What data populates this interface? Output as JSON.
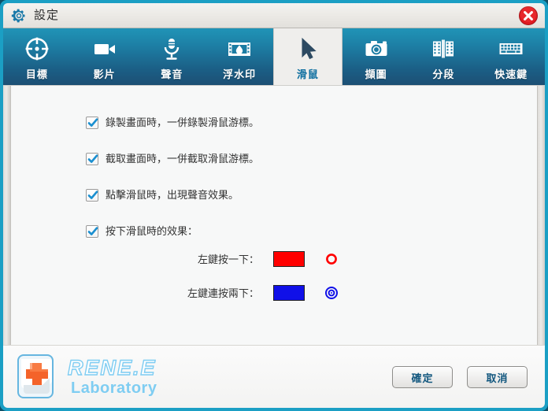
{
  "window": {
    "title": "設定",
    "gear_icon": "gear-icon",
    "close_icon": "close-icon"
  },
  "tabs": [
    {
      "label": "目標",
      "icon": "target-icon",
      "active": false
    },
    {
      "label": "影片",
      "icon": "video-camera-icon",
      "active": false
    },
    {
      "label": "聲音",
      "icon": "microphone-icon",
      "active": false
    },
    {
      "label": "浮水印",
      "icon": "watermark-icon",
      "active": false
    },
    {
      "label": "滑鼠",
      "icon": "cursor-arrow-icon",
      "active": true
    },
    {
      "label": "擷圖",
      "icon": "camera-icon",
      "active": false
    },
    {
      "label": "分段",
      "icon": "film-split-icon",
      "active": false
    },
    {
      "label": "快速鍵",
      "icon": "keyboard-icon",
      "active": false
    }
  ],
  "options": [
    {
      "label": "錄製畫面時，一併錄製滑鼠游標。",
      "checked": true
    },
    {
      "label": "截取畫面時，一併截取滑鼠游標。",
      "checked": true
    },
    {
      "label": "點擊滑鼠時，出現聲音效果。",
      "checked": true
    },
    {
      "label": "按下滑鼠時的效果：",
      "checked": true
    }
  ],
  "click_effects": [
    {
      "label": "左鍵按一下：",
      "color": "#FF0000",
      "preview": "ring-icon"
    },
    {
      "label": "左鍵連按兩下：",
      "color": "#1010E8",
      "preview": "double-ring-icon"
    }
  ],
  "logo": {
    "main": "RENE.E",
    "sub": "Laboratory",
    "icon": "keycap-cross-icon"
  },
  "footer": {
    "ok_label": "確定",
    "cancel_label": "取消"
  },
  "colors": {
    "tabbar_top": "#2094b7",
    "tabbar_bottom": "#1c4f74",
    "frame": "#1b9fc4",
    "accent_text": "#0f6fa0",
    "button_text": "#11567e",
    "logo_blue": "#7fcdf2",
    "close_red": "#e01b22"
  }
}
